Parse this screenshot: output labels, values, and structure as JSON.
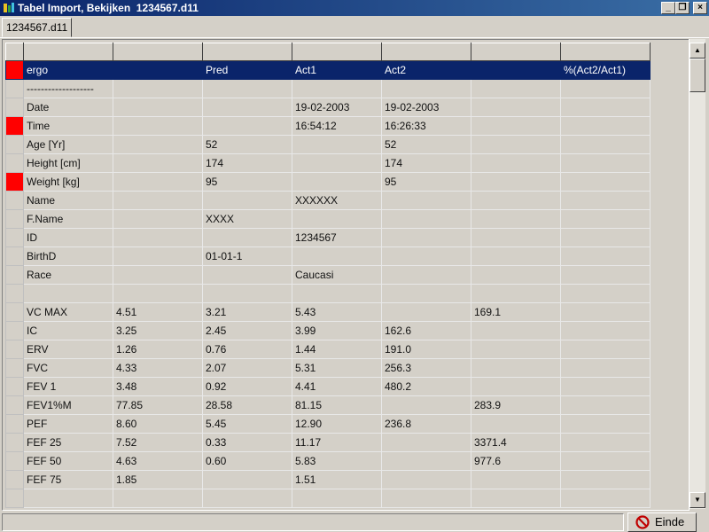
{
  "window": {
    "title": "Tabel Import, Bekijken  1234567.d11"
  },
  "tab": {
    "label": "1234567.d11"
  },
  "table": {
    "header_row": [
      "ergo",
      "",
      "Pred",
      "Act1",
      "Act2",
      "",
      "%(Act2/Act1)"
    ],
    "rows": [
      {
        "marker": false,
        "cells": [
          "-------------------",
          "",
          "",
          "",
          "",
          "",
          ""
        ]
      },
      {
        "marker": false,
        "cells": [
          "Date",
          "",
          "",
          "19-02-2003",
          "19-02-2003",
          "",
          ""
        ]
      },
      {
        "marker": true,
        "cells": [
          "Time",
          "",
          "",
          "16:54:12",
          "16:26:33",
          "",
          ""
        ]
      },
      {
        "marker": false,
        "cells": [
          "Age [Yr]",
          "",
          "52",
          "",
          "52",
          "",
          ""
        ]
      },
      {
        "marker": false,
        "cells": [
          "Height [cm]",
          "",
          "174",
          "",
          "174",
          "",
          ""
        ]
      },
      {
        "marker": true,
        "cells": [
          "Weight [kg]",
          "",
          "95",
          "",
          "95",
          "",
          ""
        ]
      },
      {
        "marker": false,
        "cells": [
          "Name",
          "",
          "",
          "XXXXXX",
          "",
          "",
          ""
        ]
      },
      {
        "marker": false,
        "cells": [
          "F.Name",
          "",
          "XXXX",
          "",
          "",
          "",
          ""
        ]
      },
      {
        "marker": false,
        "cells": [
          "ID",
          "",
          "",
          "1234567",
          "",
          "",
          ""
        ]
      },
      {
        "marker": false,
        "cells": [
          "BirthD",
          "",
          "01-01-1",
          "",
          "",
          "",
          ""
        ]
      },
      {
        "marker": false,
        "cells": [
          "Race",
          "",
          "",
          "Caucasi",
          "",
          "",
          ""
        ]
      },
      {
        "marker": false,
        "cells": [
          "",
          "",
          "",
          "",
          "",
          "",
          ""
        ]
      },
      {
        "marker": false,
        "cells": [
          "VC MAX",
          "4.51",
          "3.21",
          "5.43",
          "",
          "169.1",
          ""
        ]
      },
      {
        "marker": false,
        "cells": [
          "IC",
          "3.25",
          "2.45",
          "3.99",
          "162.6",
          "",
          ""
        ]
      },
      {
        "marker": false,
        "cells": [
          "ERV",
          "1.26",
          "0.76",
          "1.44",
          "191.0",
          "",
          ""
        ]
      },
      {
        "marker": false,
        "cells": [
          "FVC",
          "4.33",
          "2.07",
          "5.31",
          "256.3",
          "",
          ""
        ]
      },
      {
        "marker": false,
        "cells": [
          "FEV 1",
          "3.48",
          "0.92",
          "4.41",
          "480.2",
          "",
          ""
        ]
      },
      {
        "marker": false,
        "cells": [
          "FEV1%M",
          "77.85",
          "28.58",
          "81.15",
          "",
          "283.9",
          ""
        ]
      },
      {
        "marker": false,
        "cells": [
          "PEF",
          "8.60",
          "5.45",
          "12.90",
          "236.8",
          "",
          ""
        ]
      },
      {
        "marker": false,
        "cells": [
          "FEF 25",
          "7.52",
          "0.33",
          "11.17",
          "",
          "3371.4",
          ""
        ]
      },
      {
        "marker": false,
        "cells": [
          "FEF 50",
          "4.63",
          "0.60",
          "5.83",
          "",
          "977.6",
          ""
        ]
      },
      {
        "marker": false,
        "cells": [
          "FEF 75",
          "1.85",
          "",
          "1.51",
          "",
          "",
          ""
        ]
      },
      {
        "marker": false,
        "cells": [
          "",
          "",
          "",
          "",
          "",
          "",
          ""
        ]
      }
    ]
  },
  "status": {
    "einde_label": "Einde"
  },
  "colors": {
    "selection": "#0a246a",
    "marker": "#ff0000",
    "titlebar": "#0a246a"
  }
}
